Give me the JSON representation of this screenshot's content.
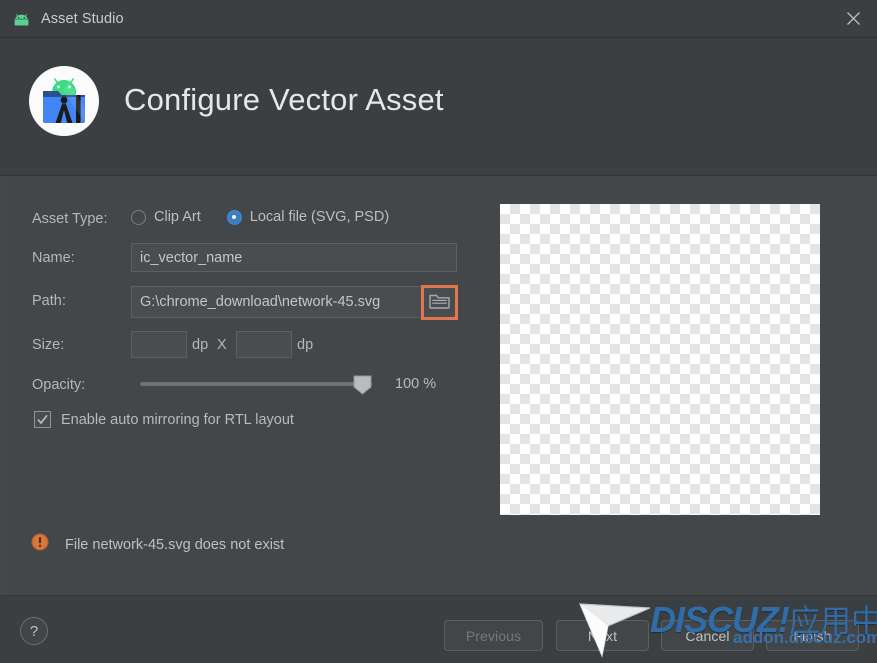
{
  "window": {
    "title": "Asset Studio",
    "app_icon": "android-robot-icon",
    "close_icon": "close-icon"
  },
  "header": {
    "title": "Configure Vector Asset",
    "icon": "android-studio-asset-icon"
  },
  "form": {
    "asset_type": {
      "label": "Asset Type:",
      "options": [
        {
          "label": "Clip Art",
          "selected": false
        },
        {
          "label": "Local file (SVG, PSD)",
          "selected": true
        }
      ]
    },
    "name": {
      "label": "Name:",
      "value": "ic_vector_name"
    },
    "path": {
      "label": "Path:",
      "value": "G:\\chrome_download\\network-45.svg",
      "browse_icon": "folder-icon",
      "browse_highlight_color": "#e0784f"
    },
    "size": {
      "label": "Size:",
      "width_value": "",
      "height_value": "",
      "unit": "dp",
      "separator": "X"
    },
    "opacity": {
      "label": "Opacity:",
      "value": 100,
      "value_text": "100 %",
      "min": 0,
      "max": 100
    },
    "mirroring": {
      "label": "Enable auto mirroring for RTL layout",
      "checked": true
    }
  },
  "validation": {
    "icon": "error-icon",
    "message": "File network-45.svg does not exist",
    "color": "#e07b3c"
  },
  "preview": {
    "name": "asset-preview",
    "transparent": true
  },
  "footer": {
    "help_label": "?",
    "buttons": [
      {
        "id": "previous",
        "label": "Previous",
        "enabled": false
      },
      {
        "id": "next",
        "label": "Next",
        "enabled": true
      },
      {
        "id": "cancel",
        "label": "Cancel",
        "enabled": true
      },
      {
        "id": "finish",
        "label": "Finish",
        "enabled": true
      }
    ]
  },
  "watermark": {
    "brand": "DISCUZ!",
    "brand_cn": "应用中心",
    "site": "addon.discuz.com",
    "color": "#2f6ca8"
  }
}
